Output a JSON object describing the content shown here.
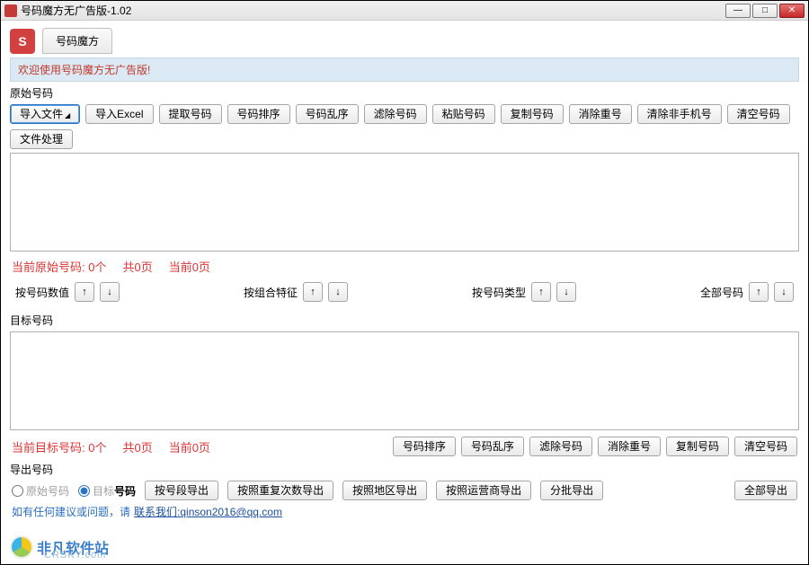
{
  "window": {
    "title": "号码魔方无广告版-1.02",
    "min": "—",
    "max": "□",
    "close": "✕"
  },
  "header": {
    "icon_letter": "S",
    "tab": "号码魔方"
  },
  "welcome": "欢迎使用号码魔方无广告版!",
  "labels": {
    "original": "原始号码",
    "target": "目标号码",
    "export": "导出号码"
  },
  "toolbar_source": {
    "import_file": "导入文件",
    "import_excel": "导入Excel",
    "extract": "提取号码",
    "sort": "号码排序",
    "shuffle": "号码乱序",
    "filter": "滤除号码",
    "paste": "粘贴号码",
    "copy": "复制号码",
    "dedupe": "消除重号",
    "clear_nonmobile": "清除非手机号",
    "clear": "清空号码",
    "file_process": "文件处理"
  },
  "status_source": {
    "count": "当前原始号码: 0个",
    "pages_total": "共0页",
    "page_current": "当前0页"
  },
  "sort_labels": {
    "by_value": "按号码数值",
    "by_combo": "按组合特征",
    "by_type": "按号码类型",
    "all": "全部号码"
  },
  "status_target": {
    "count": "当前目标号码: 0个",
    "pages_total": "共0页",
    "page_current": "当前0页"
  },
  "toolbar_target": {
    "sort": "号码排序",
    "shuffle": "号码乱序",
    "filter": "滤除号码",
    "dedupe": "消除重号",
    "copy": "复制号码",
    "clear": "清空号码"
  },
  "export": {
    "radio_source": "原始号码",
    "radio_target": "目标号码",
    "by_segment": "按号段导出",
    "by_repeat": "按照重复次数导出",
    "by_region": "按照地区导出",
    "by_carrier": "按照运营商导出",
    "batch": "分批导出",
    "all": "全部导出"
  },
  "footer": {
    "prefix": "如有任何建议或问题，请",
    "link_text": "联系我们:qinson2016@qq.com"
  },
  "arrows": {
    "up": "↑",
    "down": "↓"
  },
  "watermark": {
    "text": "非凡软件站",
    "sub": "CRSKY.com"
  }
}
